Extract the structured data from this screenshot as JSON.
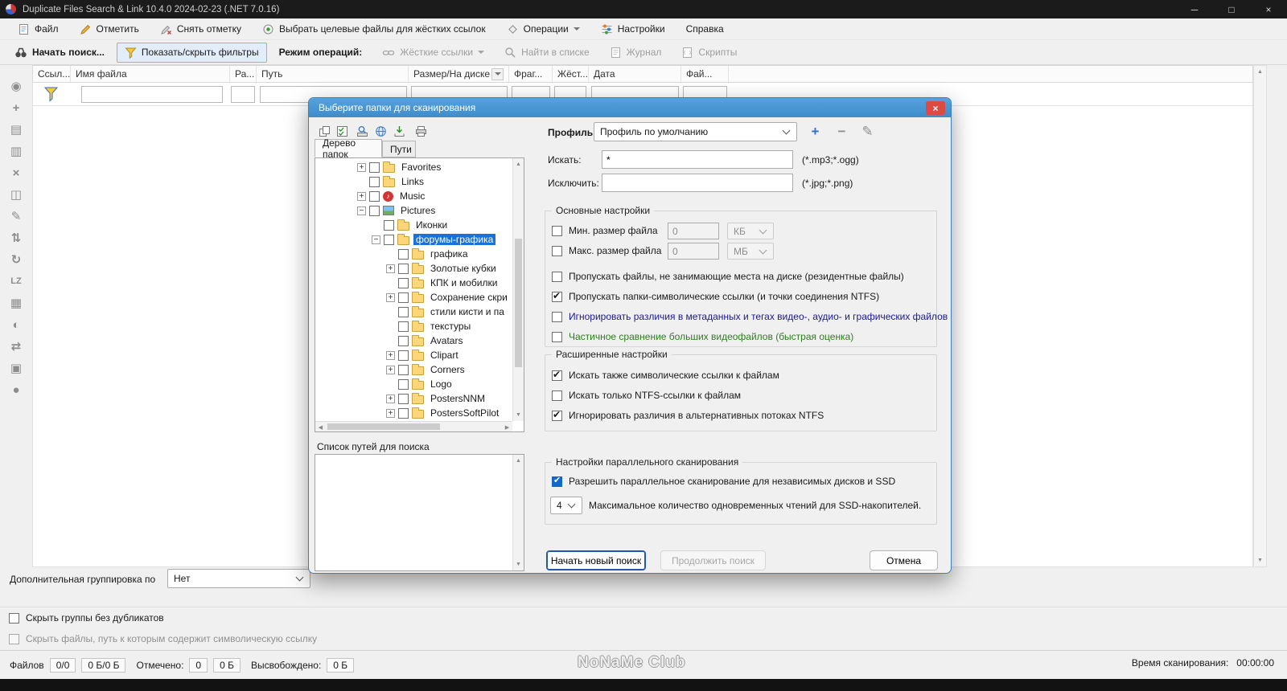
{
  "window": {
    "title": "Duplicate Files Search & Link 10.4.0 2024-02-23 (.NET 7.0.16)"
  },
  "menubar": {
    "items": [
      {
        "label": "Файл"
      },
      {
        "label": "Отметить"
      },
      {
        "label": "Снять отметку"
      },
      {
        "label": "Выбрать целевые файлы для жёстких ссылок"
      },
      {
        "label": "Операции"
      },
      {
        "label": "Настройки"
      },
      {
        "label": "Справка"
      }
    ]
  },
  "toolbar": {
    "items": [
      {
        "label": "Начать поиск...",
        "state": "normal"
      },
      {
        "label": "Показать/скрыть фильтры",
        "state": "pressed"
      },
      {
        "label": "Режим операций:",
        "state": "label"
      },
      {
        "label": "Жёсткие ссылки",
        "state": "disabled"
      },
      {
        "label": "Найти в списке",
        "state": "disabled"
      },
      {
        "label": "Журнал",
        "state": "disabled"
      },
      {
        "label": "Скрипты",
        "state": "disabled"
      }
    ]
  },
  "table": {
    "columns": [
      "Ссыл...",
      "Имя файла",
      "Ра...",
      "Путь",
      "Размер/На диске",
      "Фраг...",
      "Жёст...",
      "Дата",
      "Фай..."
    ]
  },
  "icons": {
    "sidebar": [
      {
        "name": "preview-icon",
        "glyph": "◉"
      },
      {
        "name": "filter-add-icon",
        "glyph": "+"
      },
      {
        "name": "copy-list-icon",
        "glyph": "▤"
      },
      {
        "name": "save-list-icon",
        "glyph": "▥"
      },
      {
        "name": "delete-mark-icon",
        "glyph": "×"
      },
      {
        "name": "compare-files-icon",
        "glyph": "◫"
      },
      {
        "name": "rename-icon",
        "glyph": "✎"
      },
      {
        "name": "sort-icon",
        "glyph": "⇅"
      },
      {
        "name": "refresh-icon",
        "glyph": "↻"
      },
      {
        "name": "lz-compression-icon",
        "glyph": "LZ"
      },
      {
        "name": "grid-view-icon",
        "glyph": "▦"
      },
      {
        "name": "contrast-icon",
        "glyph": "◐"
      },
      {
        "name": "swap-panels-icon",
        "glyph": "⇄"
      },
      {
        "name": "select-region-icon",
        "glyph": "▣"
      },
      {
        "name": "marker-icon",
        "glyph": "●"
      }
    ]
  },
  "bottom": {
    "grouping_label": "Дополнительная группировка по",
    "grouping_value": "Нет",
    "hide_groups_label": "Скрыть группы без дубликатов",
    "hide_files_label": "Скрыть файлы, путь к которым содержит символическую ссылку"
  },
  "statusbar": {
    "files_label": "Файлов",
    "files_value": "0/0",
    "files_size": "0 Б/0 Б",
    "marked_label": "Отмечено:",
    "marked_count": "0",
    "marked_size": "0 Б",
    "freed_label": "Высвобождено:",
    "freed_value": "0 Б",
    "watermark": "NoNaMe Club",
    "scan_time_label": "Время сканирования:",
    "scan_time_value": "00:00:00"
  },
  "dialog": {
    "title": "Выберите папки для сканирования",
    "tabs": {
      "tree": "Дерево папок",
      "paths": "Пути"
    },
    "profile": {
      "label": "Профиль:",
      "value": "Профиль по умолчанию"
    },
    "search": {
      "label": "Искать:",
      "value": "*",
      "hint": "(*.mp3;*.ogg)"
    },
    "exclude": {
      "label": "Исключить:",
      "value": "",
      "hint": "(*.jpg;*.png)"
    },
    "basic": {
      "title": "Основные настройки",
      "min": {
        "label": "Мин. размер файла",
        "value": "0",
        "unit": "КБ",
        "checked": false
      },
      "max": {
        "label": "Макс. размер файла",
        "value": "0",
        "unit": "МБ",
        "checked": false
      },
      "options": [
        {
          "label": "Пропускать файлы, не занимающие места на диске (резидентные файлы)",
          "checked": false,
          "color": "default"
        },
        {
          "label": "Пропускать папки-символические ссылки (и точки соединения NTFS)",
          "checked": true,
          "color": "default"
        },
        {
          "label": "Игнорировать различия в метаданных и тегах видео-, аудио- и графических файлов",
          "checked": false,
          "color": "navy"
        },
        {
          "label": "Частичное сравнение больших видеофайлов (быстрая оценка)",
          "checked": false,
          "color": "green"
        }
      ]
    },
    "advanced": {
      "title": "Расширенные настройки",
      "options": [
        {
          "label": "Искать также символические ссылки к файлам",
          "checked": true
        },
        {
          "label": "Искать только NTFS-ссылки к файлам",
          "checked": false
        },
        {
          "label": "Игнорировать различия в альтернативных потоках NTFS",
          "checked": true
        }
      ]
    },
    "parallel": {
      "title": "Настройки параллельного сканирования",
      "option": {
        "label": "Разрешить параллельное сканирование для независимых дисков и SSD",
        "checked": true
      },
      "threads": {
        "value": "4",
        "label": "Максимальное количество одновременных чтений для SSD-накопителей."
      }
    },
    "paths_label": "Список путей для поиска",
    "buttons": {
      "start": "Начать новый поиск",
      "continue": "Продолжить поиск",
      "cancel": "Отмена"
    },
    "tree": {
      "items": [
        {
          "label": "Favorites",
          "level": 0,
          "expand": "plus",
          "icon": "folder",
          "checked": false,
          "selected": false
        },
        {
          "label": "Links",
          "level": 0,
          "expand": "none",
          "icon": "folder",
          "checked": false,
          "selected": false
        },
        {
          "label": "Music",
          "level": 0,
          "expand": "plus",
          "icon": "music",
          "checked": false,
          "selected": false
        },
        {
          "label": "Pictures",
          "level": 0,
          "expand": "minus",
          "icon": "picture",
          "checked": false,
          "selected": false
        },
        {
          "label": "Иконки",
          "level": 1,
          "expand": "none",
          "icon": "folder",
          "checked": false,
          "selected": false
        },
        {
          "label": "форумы-графика",
          "level": 1,
          "expand": "minus",
          "icon": "folder",
          "checked": false,
          "selected": true
        },
        {
          "label": "графика",
          "level": 2,
          "expand": "none",
          "icon": "folder",
          "checked": false,
          "selected": false
        },
        {
          "label": "Золотые кубки",
          "level": 2,
          "expand": "plus",
          "icon": "folder",
          "checked": false,
          "selected": false
        },
        {
          "label": "КПК и мобилки",
          "level": 2,
          "expand": "none",
          "icon": "folder",
          "checked": false,
          "selected": false
        },
        {
          "label": "Сохранение скри",
          "level": 2,
          "expand": "plus",
          "icon": "folder",
          "checked": false,
          "selected": false
        },
        {
          "label": "стили кисти и па",
          "level": 2,
          "expand": "none",
          "icon": "folder",
          "checked": false,
          "selected": false
        },
        {
          "label": "текстуры",
          "level": 2,
          "expand": "none",
          "icon": "folder",
          "checked": false,
          "selected": false
        },
        {
          "label": "Avatars",
          "level": 2,
          "expand": "none",
          "icon": "folder",
          "checked": false,
          "selected": false
        },
        {
          "label": "Clipart",
          "level": 2,
          "expand": "plus",
          "icon": "folder",
          "checked": false,
          "selected": false
        },
        {
          "label": "Corners",
          "level": 2,
          "expand": "plus",
          "icon": "folder",
          "checked": false,
          "selected": false
        },
        {
          "label": "Logo",
          "level": 2,
          "expand": "none",
          "icon": "folder",
          "checked": false,
          "selected": false
        },
        {
          "label": "PostersNNM",
          "level": 2,
          "expand": "plus",
          "icon": "folder",
          "checked": false,
          "selected": false
        },
        {
          "label": "PostersSoftPilot",
          "level": 2,
          "expand": "plus",
          "icon": "folder",
          "checked": false,
          "selected": false
        }
      ]
    }
  }
}
